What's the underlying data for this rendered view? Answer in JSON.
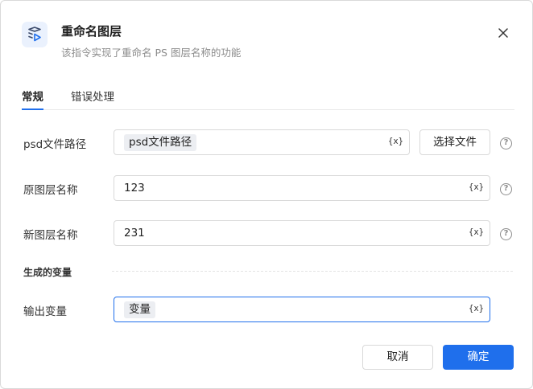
{
  "dialog": {
    "title": "重命名图层",
    "subtitle": "该指令实现了重命名 PS 图层名称的功能"
  },
  "tabs": [
    {
      "label": "常规",
      "active": true
    },
    {
      "label": "错误处理",
      "active": false
    }
  ],
  "fields": {
    "psd_path": {
      "label": "psd文件路径",
      "chip": "psd文件路径",
      "var_icon": "{x}"
    },
    "choose_file_button": "选择文件",
    "old_name": {
      "label": "原图层名称",
      "value": "123",
      "var_icon": "{x}"
    },
    "new_name": {
      "label": "新图层名称",
      "value": "231",
      "var_icon": "{x}"
    }
  },
  "generated_variables": {
    "section_title": "生成的变量",
    "output": {
      "label": "输出变量",
      "chip": "变量",
      "var_icon": "{x}"
    }
  },
  "footer": {
    "cancel_label": "取消",
    "ok_label": "确定"
  },
  "colors": {
    "accent": "#1f6fec",
    "chip_bg": "#eceef2",
    "icon_bg": "#eaf1fd"
  },
  "icons": {
    "header": "layers-play-icon",
    "close": "close-icon",
    "help": "question-circle-icon"
  }
}
